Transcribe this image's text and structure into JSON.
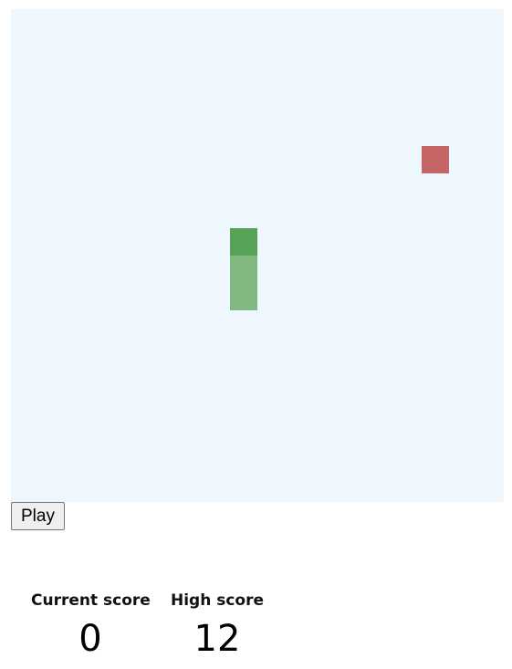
{
  "game": {
    "grid_size": 18,
    "colors": {
      "board": "#eef6fe",
      "snake_head": "#58a258",
      "snake_body": "#80b880",
      "food": "#c46464"
    },
    "snake": [
      {
        "col": 8,
        "row": 8
      },
      {
        "col": 8,
        "row": 9
      },
      {
        "col": 8,
        "row": 10
      }
    ],
    "food": {
      "col": 15,
      "row": 5
    }
  },
  "controls": {
    "play_label": "Play"
  },
  "scores": {
    "current_label": "Current score",
    "current_value": "0",
    "high_label": "High score",
    "high_value": "12"
  }
}
